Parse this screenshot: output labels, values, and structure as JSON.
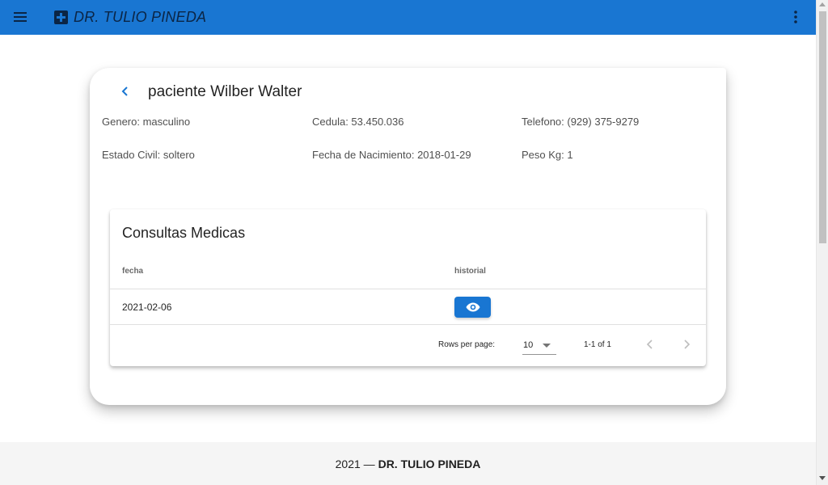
{
  "appbar": {
    "title": "DR. TULIO PINEDA",
    "menu_icon": "menu-icon",
    "brand_icon": "medical-cross-icon",
    "more_icon": "more-vert-icon",
    "color": "#1976d2"
  },
  "patient": {
    "title": "paciente Wilber Walter",
    "back_icon": "chevron-left-icon",
    "genero": "Genero: masculino",
    "cedula": "Cedula: 53.450.036",
    "telefono": "Telefono: (929) 375-9279",
    "estado_civil": "Estado Civil: soltero",
    "fecha_nacimiento": "Fecha de Nacimiento: 2018-01-29",
    "peso": "Peso Kg: 1"
  },
  "consultas": {
    "title": "Consultas Medicas",
    "columns": [
      "fecha",
      "historial"
    ],
    "rows": [
      {
        "fecha": "2021-02-06",
        "historial_icon": "eye-icon"
      }
    ],
    "pagination": {
      "rows_per_page_label": "Rows per page:",
      "rows_per_page_value": "10",
      "range": "1-1 of 1"
    }
  },
  "footer": {
    "year": "2021 —",
    "name": "DR. TULIO PINEDA"
  }
}
